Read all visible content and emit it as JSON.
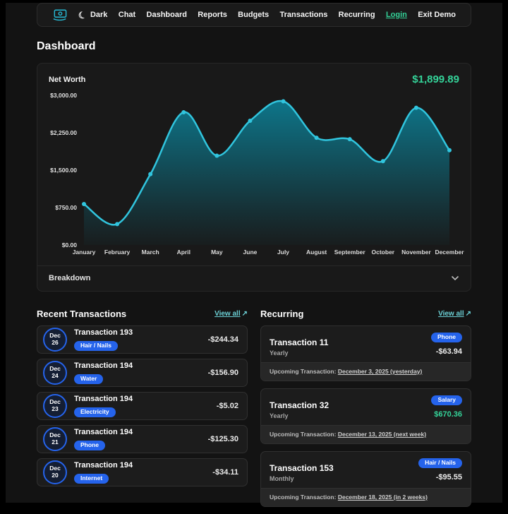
{
  "nav": {
    "theme_toggle_label": "Dark",
    "links": [
      {
        "label": "Chat"
      },
      {
        "label": "Dashboard"
      },
      {
        "label": "Reports"
      },
      {
        "label": "Budgets"
      },
      {
        "label": "Transactions"
      },
      {
        "label": "Recurring"
      }
    ],
    "login_label": "Login",
    "exit_demo_label": "Exit Demo"
  },
  "page_title": "Dashboard",
  "net_worth": {
    "title": "Net Worth",
    "value": "$1,899.89",
    "value_color": "#34d399",
    "breakdown_label": "Breakdown"
  },
  "chart_data": {
    "type": "area",
    "title": "Net Worth",
    "x": [
      "January",
      "February",
      "March",
      "April",
      "May",
      "June",
      "July",
      "August",
      "September",
      "October",
      "November",
      "December"
    ],
    "values": [
      820,
      420,
      1420,
      2660,
      1790,
      2490,
      2880,
      2150,
      2120,
      1680,
      2750,
      1899.89
    ],
    "ylim": [
      0,
      3000
    ],
    "yticks": [
      0,
      750,
      1500,
      2250,
      3000
    ],
    "ytick_labels": [
      "$0.00",
      "$750.00",
      "$1,500.00",
      "$2,250.00",
      "$3,000.00"
    ],
    "line_color": "#31c5de",
    "fill_color": "#0d7a8f",
    "grid": "off",
    "legend": "off"
  },
  "recent_transactions": {
    "title": "Recent Transactions",
    "view_all_label": "View all",
    "view_all_arrow": "↗",
    "items": [
      {
        "date_month": "Dec",
        "date_day": "26",
        "name": "Transaction 193",
        "category": "Hair / Nails",
        "amount": "-$244.34"
      },
      {
        "date_month": "Dec",
        "date_day": "24",
        "name": "Transaction 194",
        "category": "Water",
        "amount": "-$156.90"
      },
      {
        "date_month": "Dec",
        "date_day": "23",
        "name": "Transaction 194",
        "category": "Electricity",
        "amount": "-$5.02"
      },
      {
        "date_month": "Dec",
        "date_day": "21",
        "name": "Transaction 194",
        "category": "Phone",
        "amount": "-$125.30"
      },
      {
        "date_month": "Dec",
        "date_day": "20",
        "name": "Transaction 194",
        "category": "Internet",
        "amount": "-$34.11"
      }
    ]
  },
  "recurring": {
    "title": "Recurring",
    "view_all_label": "View all",
    "view_all_arrow": "↗",
    "items": [
      {
        "name": "Transaction 11",
        "frequency": "Yearly",
        "category": "Phone",
        "amount": "-$63.94",
        "amount_color": "#ececec",
        "upcoming_prefix": "Upcoming Transaction:",
        "upcoming_date": "December 3, 2025 (yesterday)"
      },
      {
        "name": "Transaction 32",
        "frequency": "Yearly",
        "category": "Salary",
        "amount": "$670.36",
        "amount_color": "#34d399",
        "upcoming_prefix": "Upcoming Transaction:",
        "upcoming_date": "December 13, 2025 (next week)"
      },
      {
        "name": "Transaction 153",
        "frequency": "Monthly",
        "category": "Hair / Nails",
        "amount": "-$95.55",
        "amount_color": "#ececec",
        "upcoming_prefix": "Upcoming Transaction:",
        "upcoming_date": "December 18, 2025 (in 2 weeks)"
      }
    ]
  },
  "colors": {
    "accent_blue": "#2563eb",
    "accent_green": "#34d399",
    "accent_cyan": "#31c5de",
    "link_teal": "#6cd1d6"
  }
}
